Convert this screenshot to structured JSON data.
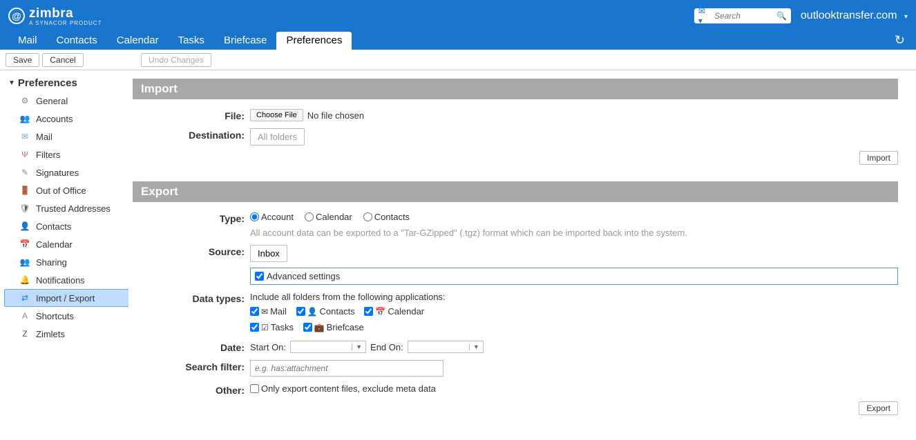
{
  "brand": {
    "name": "zimbra",
    "tag": "A SYNACOR PRODUCT"
  },
  "search": {
    "placeholder": "Search"
  },
  "account_name": "outlooktransfer.com",
  "nav": {
    "mail": "Mail",
    "contacts": "Contacts",
    "calendar": "Calendar",
    "tasks": "Tasks",
    "briefcase": "Briefcase",
    "preferences": "Preferences"
  },
  "toolbar": {
    "save": "Save",
    "cancel": "Cancel",
    "undo": "Undo Changes"
  },
  "sidebar": {
    "title": "Preferences",
    "items": [
      {
        "label": "General"
      },
      {
        "label": "Accounts"
      },
      {
        "label": "Mail"
      },
      {
        "label": "Filters"
      },
      {
        "label": "Signatures"
      },
      {
        "label": "Out of Office"
      },
      {
        "label": "Trusted Addresses"
      },
      {
        "label": "Contacts"
      },
      {
        "label": "Calendar"
      },
      {
        "label": "Sharing"
      },
      {
        "label": "Notifications"
      },
      {
        "label": "Import / Export"
      },
      {
        "label": "Shortcuts"
      },
      {
        "label": "Zimlets"
      }
    ]
  },
  "import": {
    "section": "Import",
    "file_label": "File:",
    "choose_file": "Choose File",
    "no_file": "No file chosen",
    "dest_label": "Destination:",
    "dest_value": "All folders",
    "action": "Import"
  },
  "export": {
    "section": "Export",
    "type_label": "Type:",
    "type_account": "Account",
    "type_calendar": "Calendar",
    "type_contacts": "Contacts",
    "type_help": "All account data can be exported to a \"Tar-GZipped\" (.tgz) format which can be imported back into the system.",
    "source_label": "Source:",
    "source_value": "Inbox",
    "adv_label": "Advanced settings",
    "datatypes_label": "Data types:",
    "datatypes_intro": "Include all folders from the following applications:",
    "chk_mail": "Mail",
    "chk_contacts": "Contacts",
    "chk_calendar": "Calendar",
    "chk_tasks": "Tasks",
    "chk_briefcase": "Briefcase",
    "date_label": "Date:",
    "date_start": "Start On:",
    "date_end": "End On:",
    "search_label": "Search filter:",
    "search_placeholder": "e.g. has:attachment",
    "other_label": "Other:",
    "other_chk": "Only export content files, exclude meta data",
    "action": "Export"
  }
}
